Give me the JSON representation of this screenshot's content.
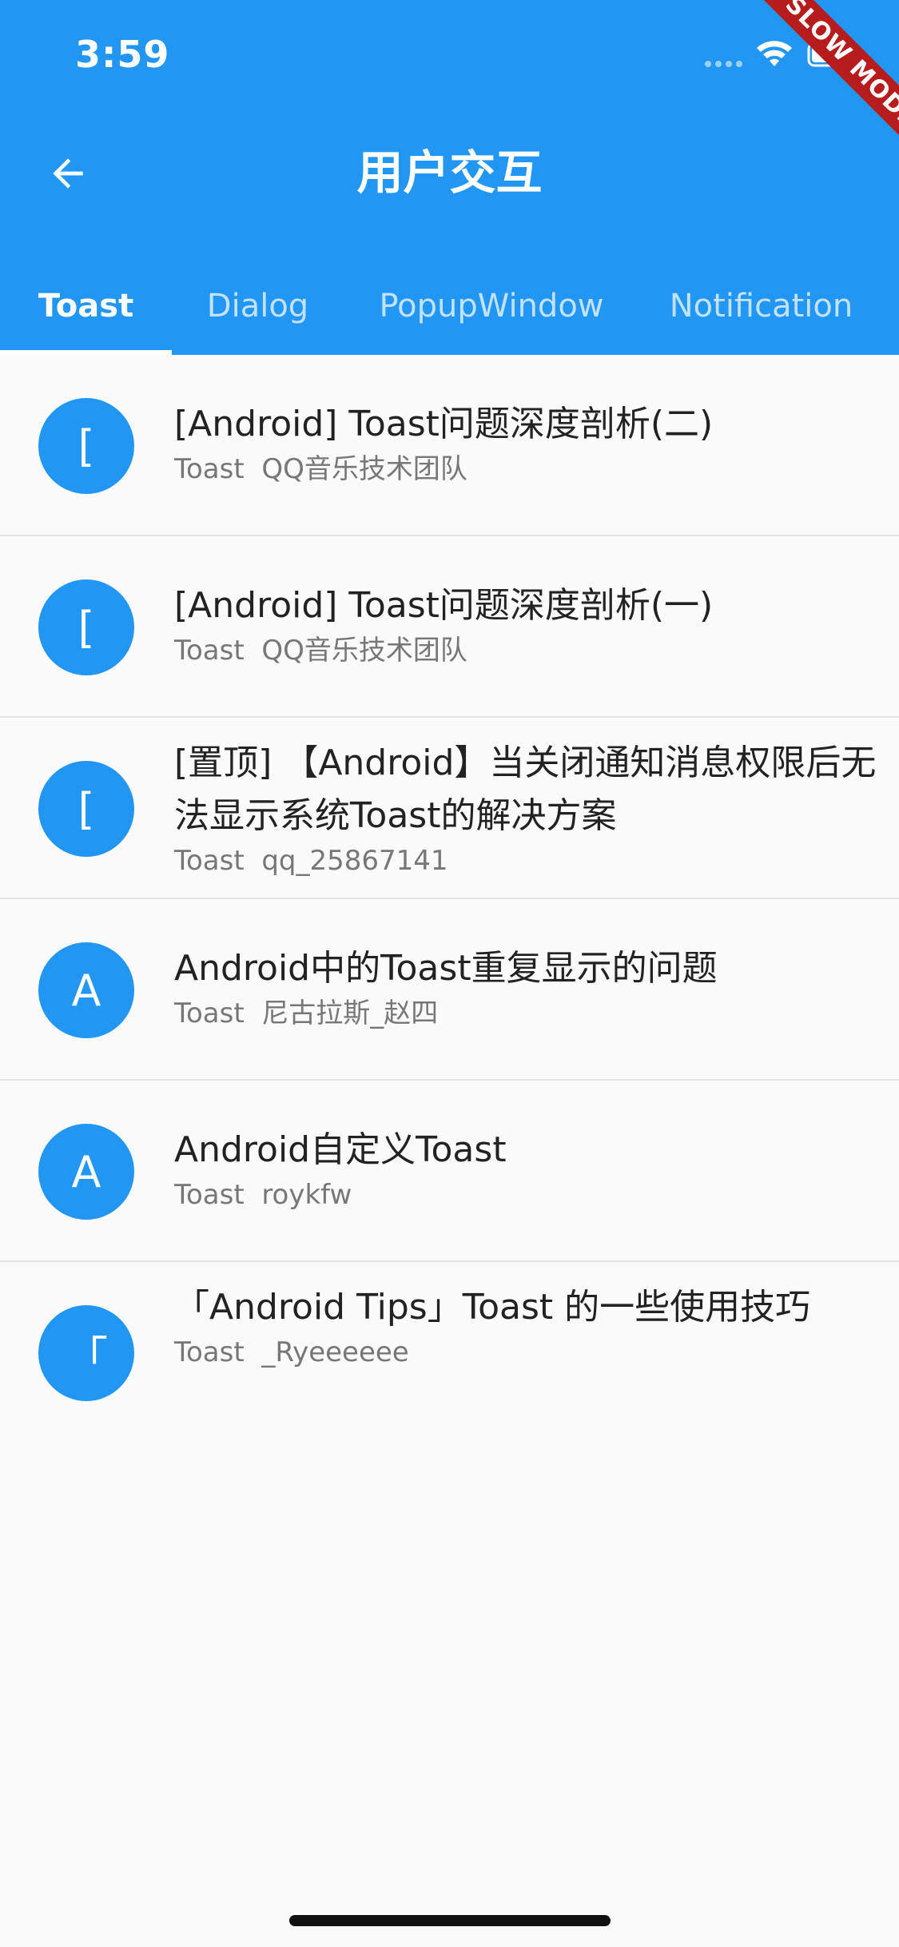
{
  "status_bar": {
    "time": "3:59"
  },
  "debug_banner": {
    "label": "SLOW MODE"
  },
  "header": {
    "title": "用户交互"
  },
  "tabs": [
    {
      "label": "Toast"
    },
    {
      "label": "Dialog"
    },
    {
      "label": "PopupWindow"
    },
    {
      "label": "Notification"
    }
  ],
  "articles": [
    {
      "avatar": "[",
      "title": "[Android] Toast问题深度剖析(二)",
      "category": "Toast",
      "author": "QQ音乐技术团队"
    },
    {
      "avatar": "[",
      "title": "[Android] Toast问题深度剖析(一)",
      "category": "Toast",
      "author": "QQ音乐技术团队"
    },
    {
      "avatar": "[",
      "title": "[置顶] 【Android】当关闭通知消息权限后无法显示系统Toast的解决方案",
      "category": "Toast",
      "author": "qq_25867141"
    },
    {
      "avatar": "A",
      "title": "Android中的Toast重复显示的问题",
      "category": "Toast",
      "author": "尼古拉斯_赵四"
    },
    {
      "avatar": "A",
      "title": "Android自定义Toast",
      "category": "Toast",
      "author": "roykfw"
    },
    {
      "avatar": "「",
      "title": "「Android Tips」Toast 的一些使用技巧",
      "category": "Toast",
      "author": "_Ryeeeeee"
    }
  ],
  "colors": {
    "primary": "#2196f3",
    "background": "#fafafa",
    "debug_banner": "#b71c1c"
  },
  "icons": {
    "back": "arrow-back-icon",
    "signal": "cellular-signal-icon",
    "wifi": "wifi-icon",
    "battery": "battery-icon"
  }
}
